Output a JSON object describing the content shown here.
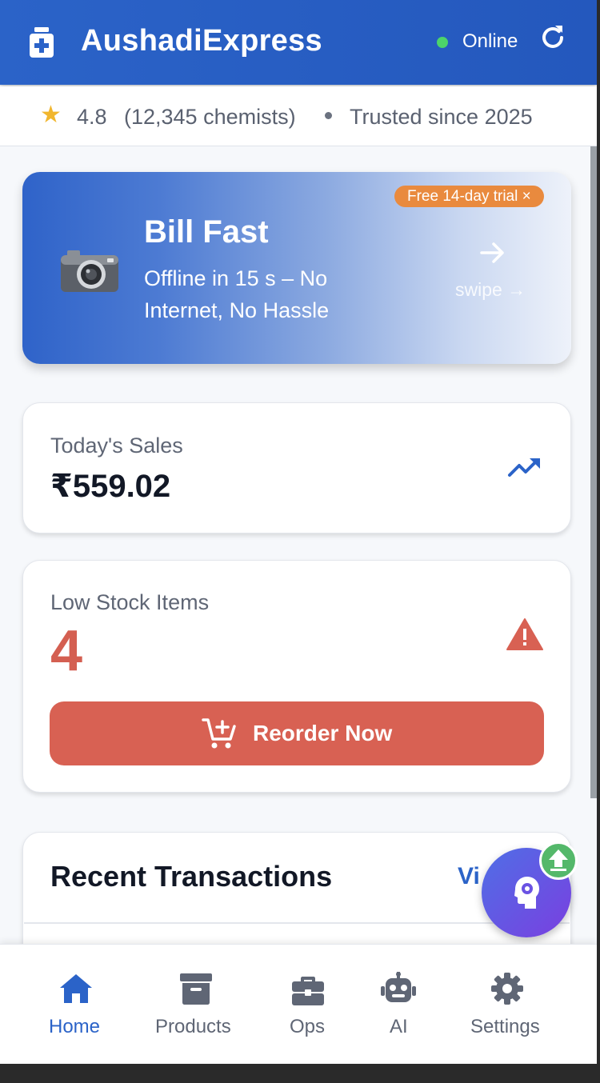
{
  "header": {
    "app_title": "AushadiExpress",
    "status_text": "Online",
    "accent_color": "#2b63c8",
    "status_color": "#4cd46a"
  },
  "rating": {
    "value": "4.8",
    "count_text": "(12,345 chemists)",
    "trusted_text": "Trusted since 2025"
  },
  "promo": {
    "badge": "Free 14-day trial ×",
    "title": "Bill Fast",
    "subtitle": "Offline in 15 s – No Internet, No Hassle",
    "swipe_hint": "swipe →"
  },
  "sales": {
    "label": "Today's Sales",
    "value": "₹559.02"
  },
  "stock": {
    "label": "Low Stock Items",
    "value": "4",
    "button_label": "Reorder Now",
    "alert_color": "#d86153"
  },
  "transactions": {
    "title": "Recent Transactions",
    "link_label": "Vi"
  },
  "nav": {
    "items": [
      {
        "label": "Home",
        "icon": "home-icon",
        "active": true
      },
      {
        "label": "Products",
        "icon": "archive-box-icon",
        "active": false
      },
      {
        "label": "Ops",
        "icon": "briefcase-icon",
        "active": false
      },
      {
        "label": "AI",
        "icon": "robot-icon",
        "active": false
      },
      {
        "label": "Settings",
        "icon": "gear-icon",
        "active": false
      }
    ]
  },
  "icons": {
    "logo": "medical-kit-icon",
    "refresh": "refresh-icon",
    "rating": "star-icon",
    "promo": "camera-icon",
    "promo_arrow": "arrow-right-icon",
    "sales": "trending-up-icon",
    "stock": "warning-icon",
    "reorder": "cart-plus-icon",
    "fab": "brain-gear-icon",
    "sync": "upload-icon"
  }
}
